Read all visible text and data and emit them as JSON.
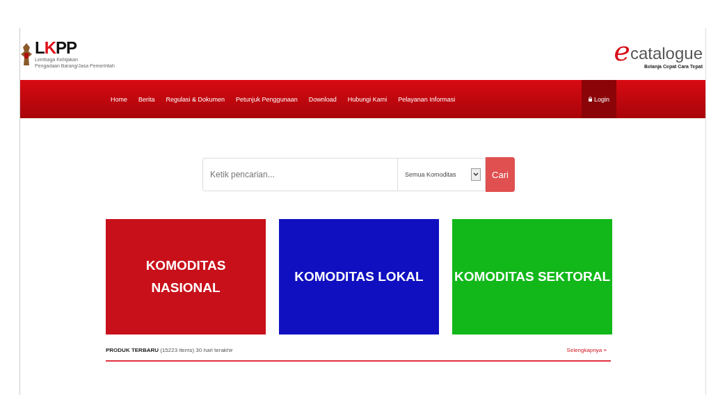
{
  "header": {
    "logo": {
      "letters": [
        {
          "text": "L",
          "color": "#111111"
        },
        {
          "text": "K",
          "color": "#e0101a"
        },
        {
          "text": "PP",
          "color": "#111111"
        }
      ],
      "lines": [
        "Lembaga Kebijakan",
        "Pengadaan Barang/Jasa Pemerintah"
      ]
    },
    "brand": {
      "initial": "e",
      "name": "catalogue",
      "tagline": "Belanja Cepat Cara Tepat"
    }
  },
  "nav": {
    "items": [
      "Home",
      "Berita",
      "Regulasi & Dokumen",
      "Petunjuk Penggunaan",
      "Download",
      "Hubungi Kami",
      "Pelayanan Informasi"
    ],
    "login": "Login"
  },
  "search": {
    "placeholder": "Ketik pencarian...",
    "category": "Semua Komoditas",
    "button": "Cari"
  },
  "tiles": [
    {
      "lines": [
        "KOMODITAS",
        "NASIONAL"
      ],
      "color": "#c8101a"
    },
    {
      "lines": [
        "KOMODITAS LOKAL"
      ],
      "color": "#1010c0"
    },
    {
      "lines": [
        "KOMODITAS SEKTORAL"
      ],
      "color": "#12b81a"
    }
  ],
  "latest": {
    "summary": "**PRODUK TERBARU** (15223 items) 30 hari terakhir",
    "link": "Selengkapnya »"
  }
}
